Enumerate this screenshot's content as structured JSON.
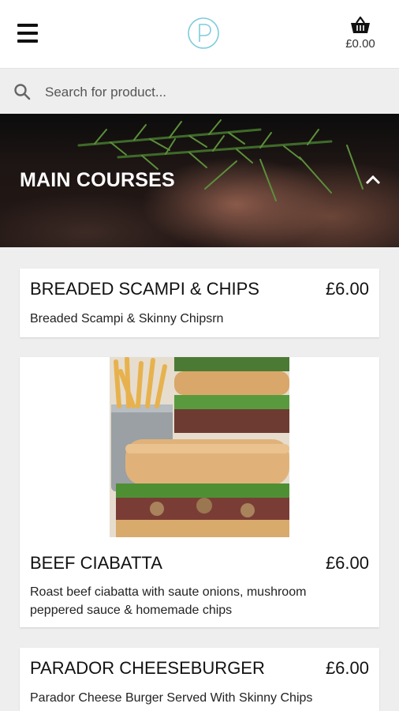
{
  "header": {
    "menu_icon": "hamburger-menu-icon",
    "logo_icon": "p-logo-icon",
    "cart_icon": "basket-icon",
    "cart_total": "£0.00",
    "brand_color": "#7ecbdc"
  },
  "search": {
    "icon": "search-icon",
    "placeholder": "Search for product..."
  },
  "category": {
    "title": "MAIN COURSES",
    "collapse_icon": "chevron-up-icon"
  },
  "products": [
    {
      "name": "BREADED SCAMPI & CHIPS",
      "price": "£6.00",
      "description": "Breaded Scampi & Skinny Chipsrn"
    },
    {
      "name": "BEEF CIABATTA",
      "price": "£6.00",
      "description": "Roast beef ciabatta with saute onions, mushroom peppered sauce & homemade chips"
    },
    {
      "name": "PARADOR CHEESEBURGER",
      "price": "£6.00",
      "description": "Parador Cheese Burger Served With Skinny Chips"
    }
  ]
}
